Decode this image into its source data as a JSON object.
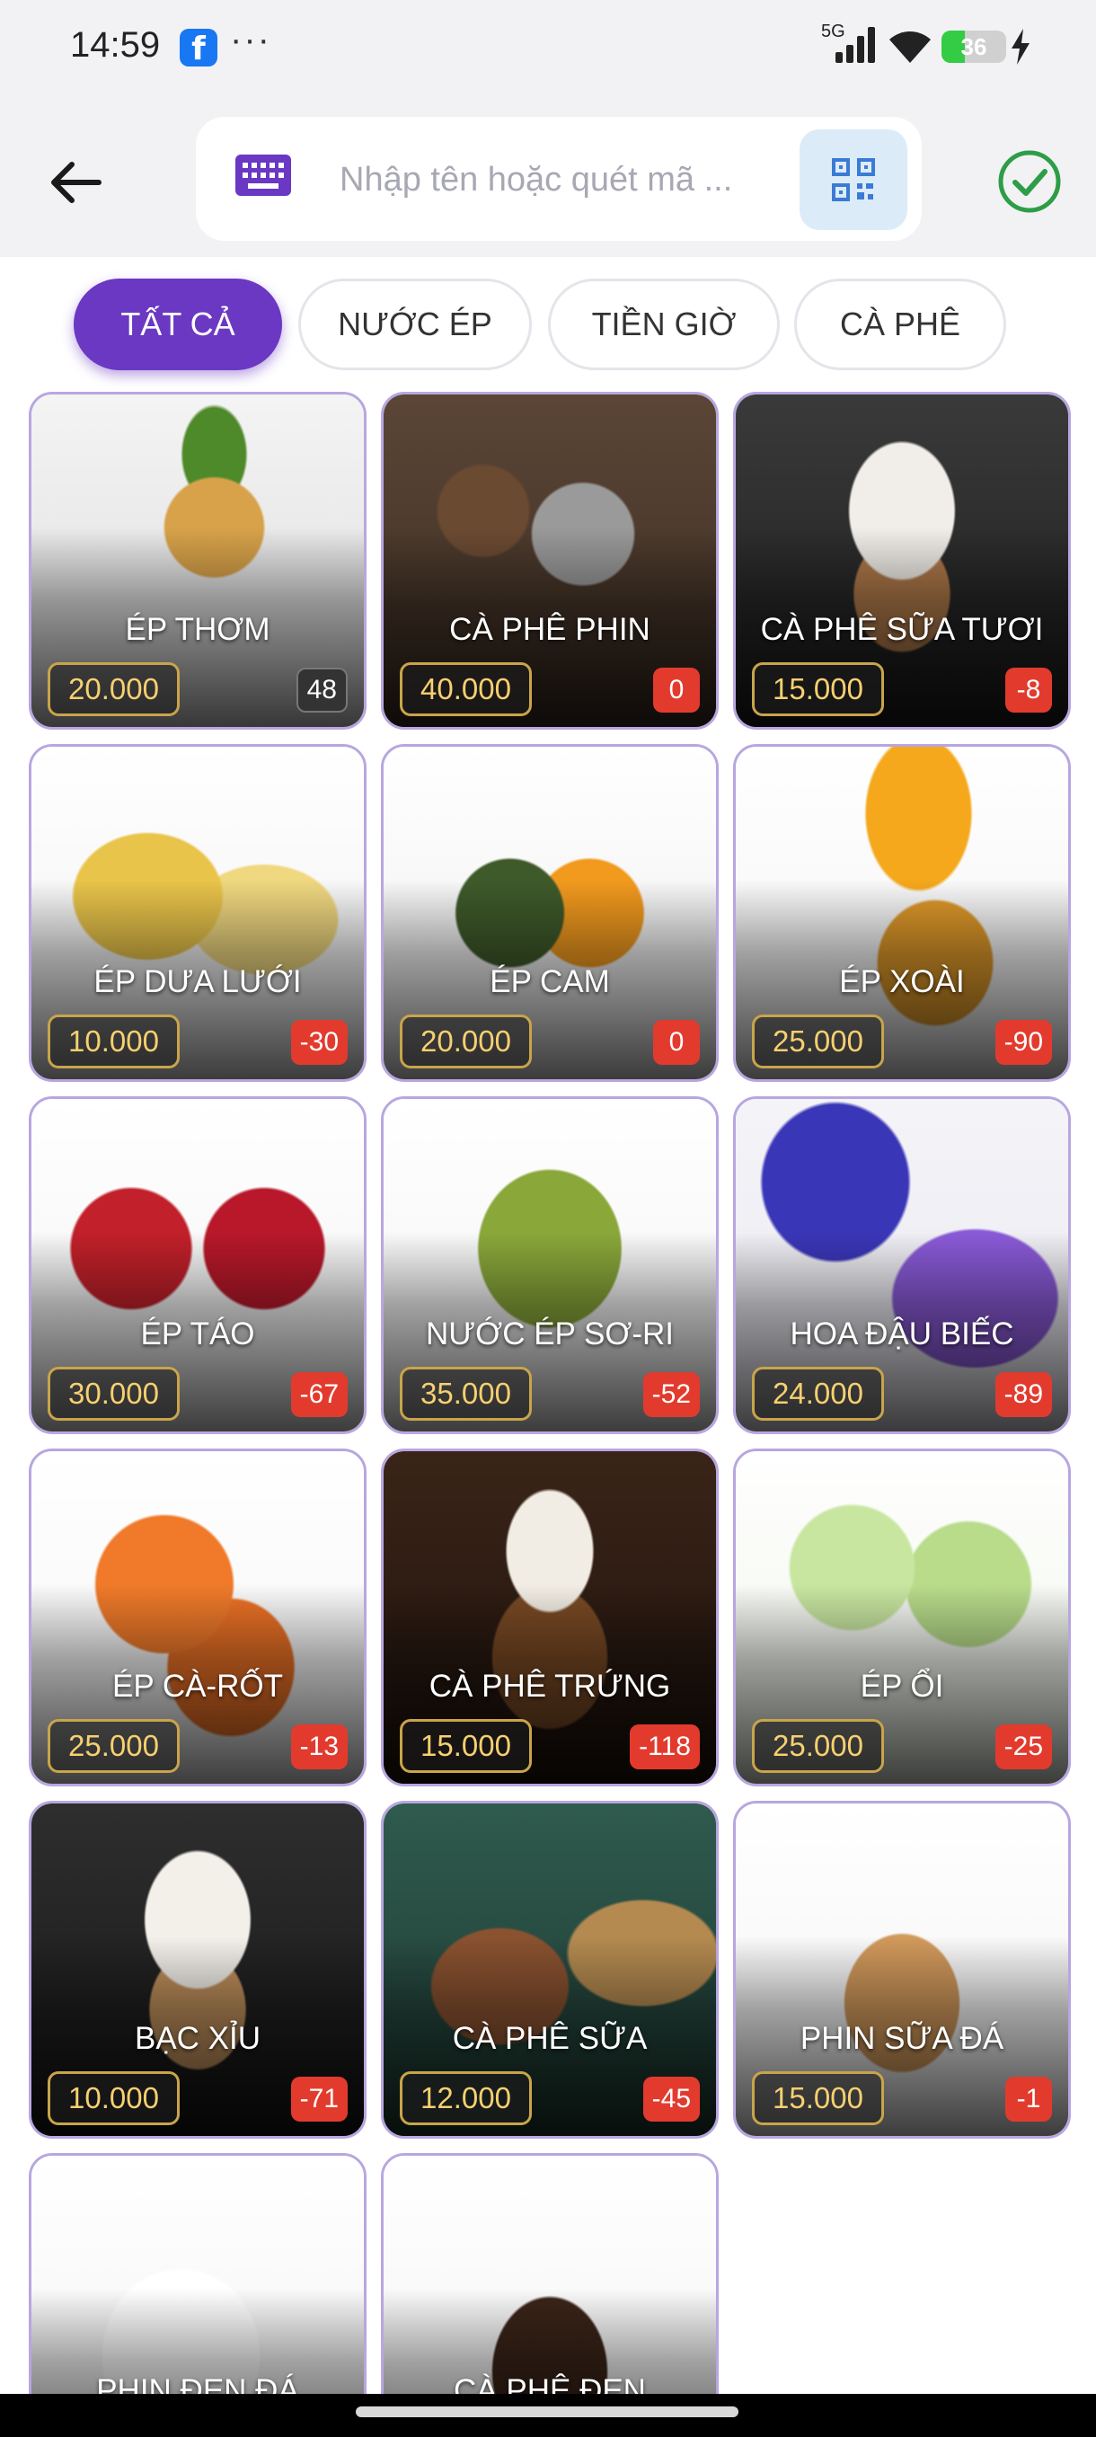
{
  "status_bar": {
    "time": "14:59",
    "network": "5G",
    "battery": "36",
    "battery_level": 0.36,
    "icons": [
      "facebook-icon",
      "more-icon",
      "signal-icon",
      "wifi-icon",
      "battery-icon",
      "charging-icon"
    ]
  },
  "header": {
    "back_icon": "arrow-left-icon",
    "search_placeholder": "Nhập tên hoặc quét mã ...",
    "keyboard_icon": "keyboard-icon",
    "qr_icon": "qr-code-icon",
    "confirm_icon": "check-circle-icon"
  },
  "colors": {
    "accent": "#6a38c2",
    "card_border": "#b8a6e0",
    "price_text": "#f7d070",
    "stock_negative": "#e23b2e",
    "confirm": "#2e9d48"
  },
  "tabs": [
    {
      "label": "TẤT CẢ",
      "active": true
    },
    {
      "label": "NƯỚC ÉP",
      "active": false
    },
    {
      "label": "TIỀN GIỜ",
      "active": false
    },
    {
      "label": "CÀ PHÊ",
      "active": false
    }
  ],
  "products": [
    {
      "name": "ÉP THƠM",
      "price": "20.000",
      "stock": "48"
    },
    {
      "name": "CÀ PHÊ PHIN",
      "price": "40.000",
      "stock": "0"
    },
    {
      "name": "CÀ PHÊ SỮA TƯƠI",
      "price": "15.000",
      "stock": "-8"
    },
    {
      "name": "ÉP DƯA LƯỚI",
      "price": "10.000",
      "stock": "-30"
    },
    {
      "name": "ÉP CAM",
      "price": "20.000",
      "stock": "0"
    },
    {
      "name": "ÉP XOÀI",
      "price": "25.000",
      "stock": "-90"
    },
    {
      "name": "ÉP TÁO",
      "price": "30.000",
      "stock": "-67"
    },
    {
      "name": "NƯỚC ÉP SƠ-RI",
      "price": "35.000",
      "stock": "-52"
    },
    {
      "name": "HOA ĐẬU BIẾC",
      "price": "24.000",
      "stock": "-89"
    },
    {
      "name": "ÉP CÀ-RỐT",
      "price": "25.000",
      "stock": "-13"
    },
    {
      "name": "CÀ PHÊ TRỨNG",
      "price": "15.000",
      "stock": "-118"
    },
    {
      "name": "ÉP ỔI",
      "price": "25.000",
      "stock": "-25"
    },
    {
      "name": "BẠC XỈU",
      "price": "10.000",
      "stock": "-71"
    },
    {
      "name": "CÀ PHÊ SỮA",
      "price": "12.000",
      "stock": "-45"
    },
    {
      "name": "PHIN SỮA ĐÁ",
      "price": "15.000",
      "stock": "-1"
    },
    {
      "name": "PHIN ĐEN ĐÁ",
      "price": "",
      "stock": ""
    },
    {
      "name": "CÀ PHÊ ĐEN",
      "price": "",
      "stock": ""
    }
  ]
}
